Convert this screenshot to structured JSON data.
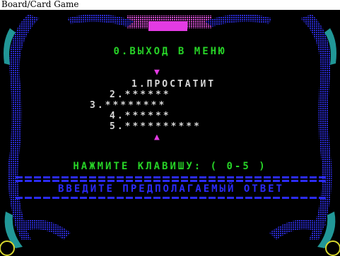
{
  "window": {
    "title": "Board/Card Game"
  },
  "menu": {
    "exit_label": "0.ВЫХОД В МЕНЮ",
    "up_arrow": "▼",
    "down_arrow": "▲",
    "options": [
      {
        "label": "1.ПРОСТАТИТ"
      },
      {
        "label": "2.******"
      },
      {
        "label": "3.********"
      },
      {
        "label": "4.******"
      },
      {
        "label": "5.**********"
      }
    ]
  },
  "prompt": {
    "text": "НАЖМИТЕ КЛАВИШУ: ( 0-5 )"
  },
  "answer": {
    "text": "ВВЕДИТЕ ПРЕДПОЛАГАЕМЫЙ ОТВЕТ"
  },
  "colors": {
    "green": "#27d327",
    "white": "#d8d8d8",
    "magenta": "#e33be3",
    "blue": "#2b2bff",
    "frame_blue": "#2a2ad0",
    "frame_cyan": "#2fd7d7",
    "frame_yellow": "#d7d72f"
  }
}
